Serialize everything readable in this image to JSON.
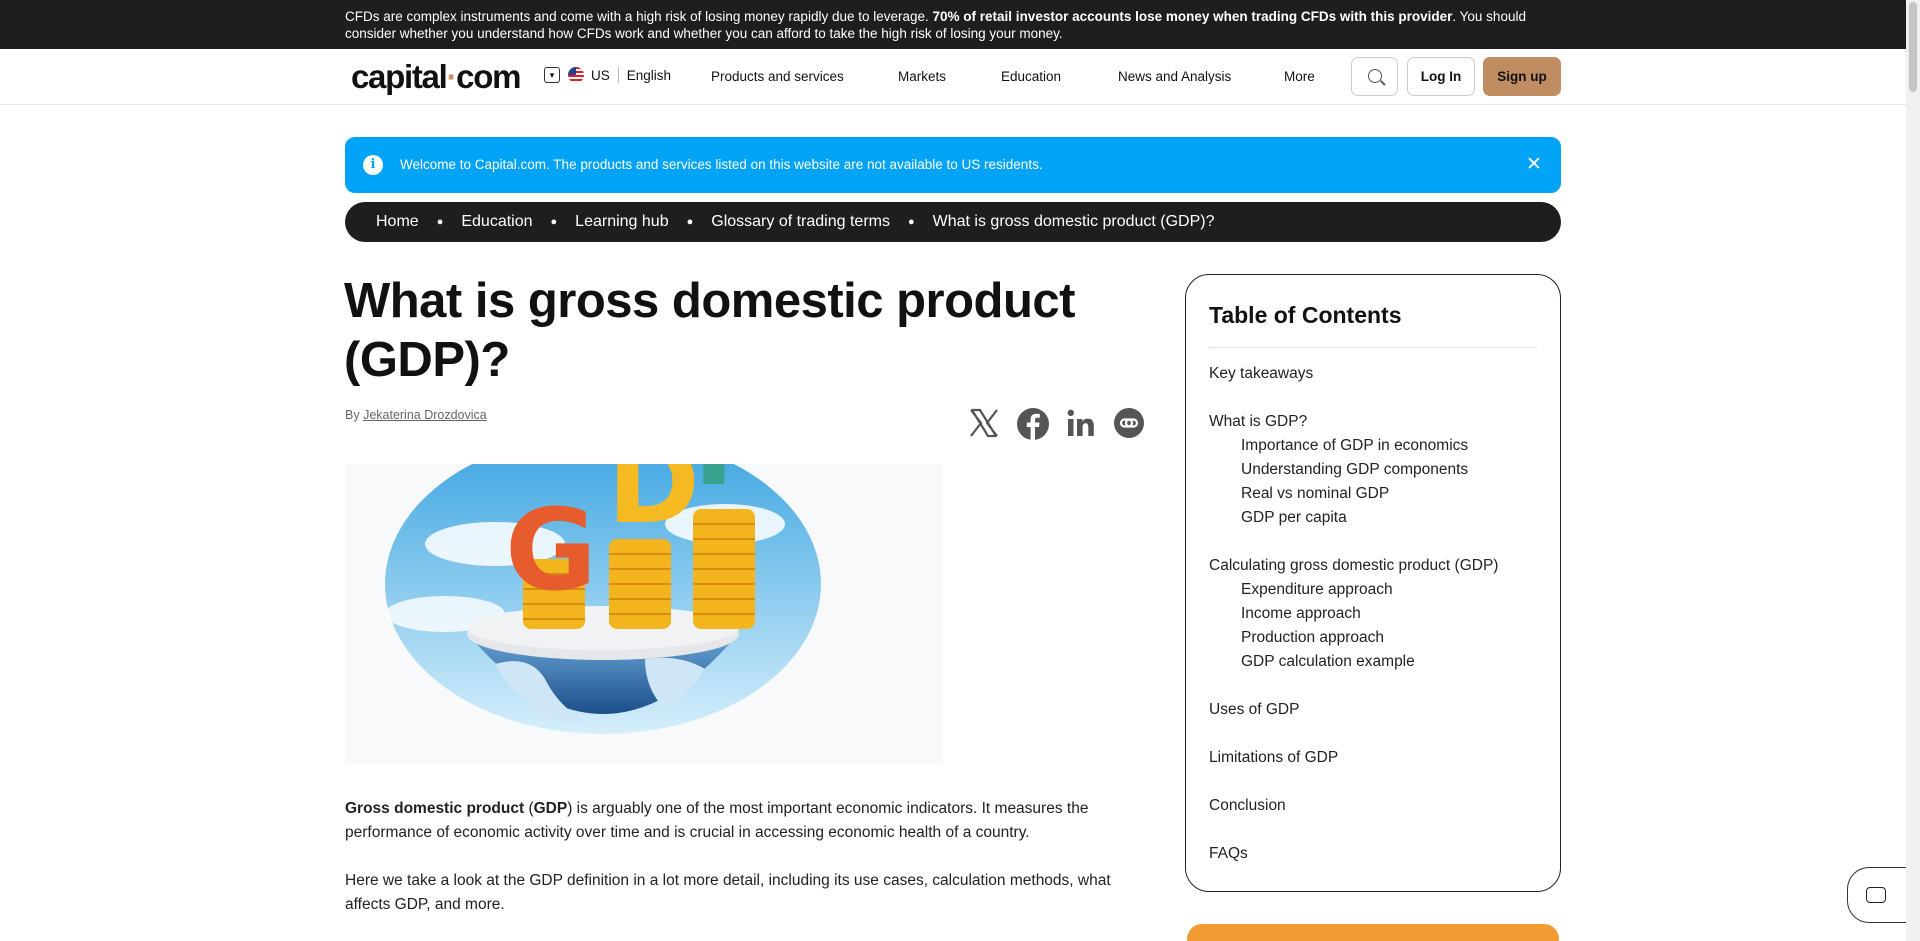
{
  "risk_warning": {
    "before": "CFDs are complex instruments and come with a high risk of losing money rapidly due to leverage. ",
    "bold": "70% of retail investor accounts lose money when trading CFDs with this provider",
    "after": ". You should consider whether you understand how CFDs work and whether you can afford to take the high risk of losing your money."
  },
  "header": {
    "logo_main": "capital",
    "logo_dot": "·",
    "logo_tld": "com",
    "region": "US",
    "language": "English",
    "nav": [
      "Products and services",
      "Markets",
      "Education",
      "News and Analysis",
      "More"
    ],
    "login": "Log In",
    "signup": "Sign up"
  },
  "notice": {
    "message": "Welcome to Capital.com. The products and services listed on this website are not available to US residents.",
    "close": "✕"
  },
  "breadcrumb": [
    "Home",
    "Education",
    "Learning hub",
    "Glossary of trading terms",
    "What is gross domestic product (GDP)?"
  ],
  "article": {
    "title": "What is gross domestic product (GDP)?",
    "by": "By ",
    "author": "Jekaterina Drozdovica",
    "hero_text": "GDP",
    "p1_bold1": "Gross domestic product",
    "p1_open": " (",
    "p1_bold2": "GDP",
    "p1_rest": ") is arguably one of the most important economic indicators. It measures the performance of economic activity over time and is crucial in accessing economic health of a country.",
    "p2": "Here we take a look at the GDP definition in a lot more detail, including its use cases, calculation methods, what affects GDP, and more."
  },
  "share_icons": [
    "x-icon",
    "facebook-icon",
    "linkedin-icon",
    "copy-link-icon"
  ],
  "toc": {
    "title": "Table of Contents",
    "items": [
      {
        "label": "Key takeaways",
        "level": 1
      },
      {
        "label": "What is GDP?",
        "level": 1
      },
      {
        "label": "Importance of GDP in economics",
        "level": 2
      },
      {
        "label": "Understanding GDP components",
        "level": 2
      },
      {
        "label": "Real vs nominal GDP",
        "level": 2
      },
      {
        "label": "GDP per capita",
        "level": 2
      },
      {
        "label": "Calculating gross domestic product (GDP)",
        "level": 1
      },
      {
        "label": "Expenditure approach",
        "level": 2
      },
      {
        "label": "Income approach",
        "level": 2
      },
      {
        "label": "Production approach",
        "level": 2
      },
      {
        "label": "GDP calculation example",
        "level": 2
      },
      {
        "label": "Uses of GDP",
        "level": 1
      },
      {
        "label": "Limitations of GDP",
        "level": 1
      },
      {
        "label": "Conclusion",
        "level": 1
      },
      {
        "label": "FAQs",
        "level": 1
      }
    ]
  },
  "colors": {
    "accent": "#c08d62",
    "notice_blue": "#00a3f5",
    "dark": "#1e1e1e",
    "orange": "#f29b32"
  }
}
